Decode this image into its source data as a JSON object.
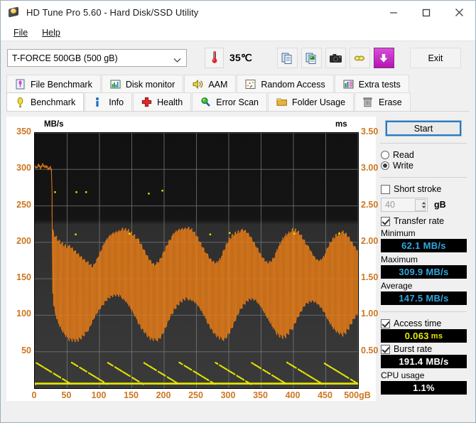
{
  "window": {
    "title": "HD Tune Pro 5.60 - Hard Disk/SSD Utility",
    "app_icon": "hdtune-icon",
    "minimize_label": "minimize-icon",
    "maximize_label": "maximize-icon",
    "close_label": "close-icon"
  },
  "menu": {
    "items": [
      {
        "label": "File"
      },
      {
        "label": "Help"
      }
    ]
  },
  "toolbar": {
    "drive_selected": "T-FORCE 500GB (500 gB)",
    "temperature": "35℃",
    "temp_icon": "thermometer-icon",
    "buttons": [
      {
        "name": "copy-icon"
      },
      {
        "name": "copy-image-icon"
      },
      {
        "name": "screenshot-camera-icon"
      },
      {
        "name": "link-icon"
      },
      {
        "name": "download-arrow-icon"
      }
    ],
    "exit_label": "Exit"
  },
  "tabs": {
    "row1": [
      {
        "label": "File Benchmark",
        "icon": "file-benchmark-icon",
        "active": false
      },
      {
        "label": "Disk monitor",
        "icon": "disk-monitor-icon",
        "active": false
      },
      {
        "label": "AAM",
        "icon": "aam-speaker-icon",
        "active": false
      },
      {
        "label": "Random Access",
        "icon": "random-access-icon",
        "active": false
      },
      {
        "label": "Extra tests",
        "icon": "extra-tests-icon",
        "active": false
      }
    ],
    "row2": [
      {
        "label": "Benchmark",
        "icon": "benchmark-bulb-icon",
        "active": true
      },
      {
        "label": "Info",
        "icon": "info-icon",
        "active": false
      },
      {
        "label": "Health",
        "icon": "health-cross-icon",
        "active": false
      },
      {
        "label": "Error Scan",
        "icon": "error-scan-magnifier-icon",
        "active": false
      },
      {
        "label": "Folder Usage",
        "icon": "folder-usage-icon",
        "active": false
      },
      {
        "label": "Erase",
        "icon": "erase-trash-icon",
        "active": false
      }
    ]
  },
  "sidebar": {
    "start_label": "Start",
    "mode": {
      "read_label": "Read",
      "write_label": "Write",
      "selected": "Write"
    },
    "short_stroke": {
      "label": "Short stroke",
      "checked": false,
      "value": "40",
      "unit": "gB"
    },
    "transfer_rate": {
      "label": "Transfer rate",
      "checked": true
    },
    "minimum": {
      "label": "Minimum",
      "value": "62.1 MB/s"
    },
    "maximum": {
      "label": "Maximum",
      "value": "309.9 MB/s"
    },
    "average": {
      "label": "Average",
      "value": "147.5 MB/s"
    },
    "access_time": {
      "label": "Access time",
      "checked": true,
      "value": "0.063",
      "unit": "ms"
    },
    "burst_rate": {
      "label": "Burst rate",
      "checked": true,
      "value": "191.4 MB/s"
    },
    "cpu_usage": {
      "label": "CPU usage",
      "value": "1.1%"
    }
  },
  "chart_data": {
    "type": "line",
    "title": "",
    "xlabel": "500gB",
    "ylabel": "MB/s",
    "y2label": "ms",
    "xlim": [
      0,
      500
    ],
    "ylim": [
      0,
      350
    ],
    "y2lim": [
      0,
      3.5
    ],
    "grid": true,
    "legend": "none",
    "xticks": [
      "0",
      "50",
      "100",
      "150",
      "200",
      "250",
      "300",
      "350",
      "400",
      "450",
      "500gB"
    ],
    "xtick_values": [
      0,
      50,
      100,
      150,
      200,
      250,
      300,
      350,
      400,
      450,
      500
    ],
    "yticks": [
      "50",
      "100",
      "150",
      "200",
      "250",
      "300",
      "350"
    ],
    "ytick_values": [
      50,
      100,
      150,
      200,
      250,
      300,
      350
    ],
    "y2ticks": [
      "0.50",
      "1.00",
      "1.50",
      "2.00",
      "2.50",
      "3.00",
      "3.50"
    ],
    "y2tick_values": [
      0.5,
      1.0,
      1.5,
      2.0,
      2.5,
      3.0,
      3.5
    ],
    "colors": {
      "transfer_rate": "#e87d18",
      "access_time": "#e8e800",
      "axis_text": "#cc7722",
      "grid": "#7a7a7a",
      "background": "#141414"
    },
    "series": [
      {
        "name": "Transfer rate",
        "unit": "MB/s",
        "axis": "left",
        "color": "#e87d18",
        "note": "Sustained SLC-cache burst ~305 MB/s for first ~25 gB, then oscillating band between ~62 and ~225 MB/s for remainder of drive.",
        "x": [
          0,
          3,
          6,
          9,
          12,
          15,
          18,
          21,
          24,
          26,
          28,
          30,
          33,
          36,
          40,
          45,
          50,
          55,
          60,
          65,
          70,
          75,
          80,
          85,
          90,
          95,
          100,
          105,
          110,
          115,
          120,
          125,
          130,
          135,
          140,
          145,
          150,
          155,
          160,
          165,
          170,
          175,
          180,
          185,
          190,
          195,
          200,
          205,
          210,
          215,
          220,
          225,
          230,
          235,
          240,
          245,
          250,
          255,
          260,
          265,
          270,
          275,
          280,
          285,
          290,
          295,
          300,
          305,
          310,
          315,
          320,
          325,
          330,
          335,
          340,
          345,
          350,
          355,
          360,
          365,
          370,
          375,
          380,
          385,
          390,
          395,
          400,
          405,
          410,
          415,
          420,
          425,
          430,
          435,
          440,
          445,
          450,
          455,
          460,
          465,
          470,
          475,
          480,
          485,
          490,
          495,
          500
        ],
        "y_envelope_high": [
          305,
          303,
          308,
          302,
          309,
          304,
          306,
          301,
          305,
          300,
          215,
          212,
          210,
          206,
          203,
          200,
          198,
          196,
          192,
          188,
          184,
          180,
          176,
          172,
          168,
          176,
          186,
          196,
          204,
          210,
          214,
          216,
          218,
          220,
          220,
          219,
          216,
          212,
          206,
          198,
          190,
          182,
          176,
          172,
          174,
          180,
          190,
          200,
          208,
          214,
          218,
          220,
          221,
          222,
          221,
          218,
          212,
          204,
          196,
          188,
          180,
          176,
          174,
          178,
          186,
          196,
          206,
          212,
          216,
          218,
          219,
          218,
          214,
          208,
          200,
          192,
          184,
          178,
          174,
          176,
          182,
          192,
          202,
          210,
          215,
          218,
          220,
          219,
          215,
          208,
          200,
          192,
          184,
          178,
          176,
          180,
          188,
          198,
          206,
          212,
          216,
          217,
          215,
          210,
          203,
          196,
          190
        ],
        "y_envelope_low": [
          303,
          301,
          305,
          300,
          306,
          302,
          303,
          299,
          302,
          297,
          120,
          108,
          96,
          88,
          80,
          72,
          66,
          64,
          63,
          62,
          64,
          68,
          74,
          82,
          92,
          100,
          106,
          112,
          118,
          122,
          124,
          125,
          124,
          122,
          118,
          112,
          104,
          96,
          88,
          80,
          74,
          68,
          64,
          63,
          64,
          68,
          76,
          86,
          96,
          104,
          110,
          115,
          118,
          120,
          120,
          118,
          114,
          108,
          100,
          92,
          84,
          76,
          70,
          66,
          64,
          66,
          72,
          80,
          90,
          100,
          108,
          114,
          118,
          120,
          119,
          116,
          110,
          102,
          94,
          86,
          78,
          72,
          68,
          66,
          68,
          74,
          82,
          92,
          100,
          108,
          114,
          117,
          118,
          116,
          112,
          106,
          98,
          90,
          82,
          76,
          72,
          70,
          72,
          78,
          86,
          94,
          100
        ]
      },
      {
        "name": "Access time",
        "unit": "ms",
        "axis": "right",
        "color": "#e8e800",
        "note": "Dense scatter of access-time samples hugging the baseline near 0.06 ms, with occasional outliers up to ~0.35 ms and a few isolated spikes near 2.1-2.7 ms.",
        "baseline_ms": 0.063,
        "outliers": [
          {
            "x": 30,
            "ms": 2.7
          },
          {
            "x": 63,
            "ms": 2.7
          },
          {
            "x": 78,
            "ms": 2.7
          },
          {
            "x": 175,
            "ms": 2.68
          },
          {
            "x": 196,
            "ms": 2.72
          },
          {
            "x": 62,
            "ms": 2.12
          },
          {
            "x": 145,
            "ms": 2.13
          },
          {
            "x": 270,
            "ms": 2.12
          },
          {
            "x": 300,
            "ms": 2.14
          },
          {
            "x": 400,
            "ms": 2.13
          },
          {
            "x": 470,
            "ms": 2.13
          }
        ]
      }
    ]
  }
}
